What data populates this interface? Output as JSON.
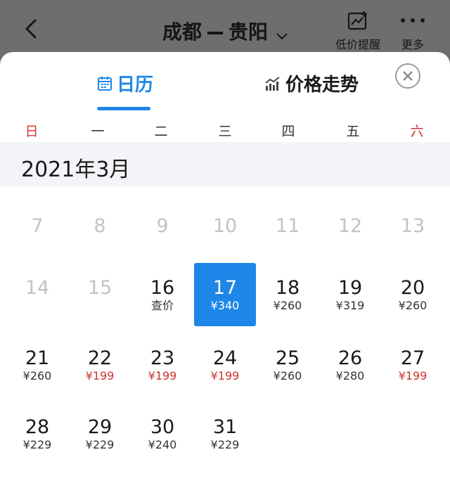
{
  "header": {
    "origin": "成都",
    "destination": "贵阳",
    "low_price_alert": "低价提醒",
    "more": "更多"
  },
  "tabs": {
    "calendar": "日历",
    "price_trend": "价格走势"
  },
  "weekdays": [
    "日",
    "一",
    "二",
    "三",
    "四",
    "五",
    "六"
  ],
  "month": "2021年3月",
  "colors": {
    "accent": "#1d86e8",
    "low_price": "#d0342c",
    "weekend": "#d0342c"
  },
  "days": [
    {
      "day": "7",
      "price": "",
      "state": "disabled"
    },
    {
      "day": "8",
      "price": "",
      "state": "disabled"
    },
    {
      "day": "9",
      "price": "",
      "state": "disabled"
    },
    {
      "day": "10",
      "price": "",
      "state": "disabled"
    },
    {
      "day": "11",
      "price": "",
      "state": "disabled"
    },
    {
      "day": "12",
      "price": "",
      "state": "disabled"
    },
    {
      "day": "13",
      "price": "",
      "state": "disabled"
    },
    {
      "day": "14",
      "price": "",
      "state": "disabled"
    },
    {
      "day": "15",
      "price": "",
      "state": "disabled"
    },
    {
      "day": "16",
      "price": "查价",
      "state": "normal"
    },
    {
      "day": "17",
      "price": "¥340",
      "state": "selected"
    },
    {
      "day": "18",
      "price": "¥260",
      "state": "normal"
    },
    {
      "day": "19",
      "price": "¥319",
      "state": "normal"
    },
    {
      "day": "20",
      "price": "¥260",
      "state": "normal"
    },
    {
      "day": "21",
      "price": "¥260",
      "state": "normal"
    },
    {
      "day": "22",
      "price": "¥199",
      "state": "low"
    },
    {
      "day": "23",
      "price": "¥199",
      "state": "low"
    },
    {
      "day": "24",
      "price": "¥199",
      "state": "low"
    },
    {
      "day": "25",
      "price": "¥260",
      "state": "normal"
    },
    {
      "day": "26",
      "price": "¥280",
      "state": "normal"
    },
    {
      "day": "27",
      "price": "¥199",
      "state": "low"
    },
    {
      "day": "28",
      "price": "¥229",
      "state": "normal"
    },
    {
      "day": "29",
      "price": "¥229",
      "state": "normal"
    },
    {
      "day": "30",
      "price": "¥240",
      "state": "normal"
    },
    {
      "day": "31",
      "price": "¥229",
      "state": "normal"
    }
  ]
}
